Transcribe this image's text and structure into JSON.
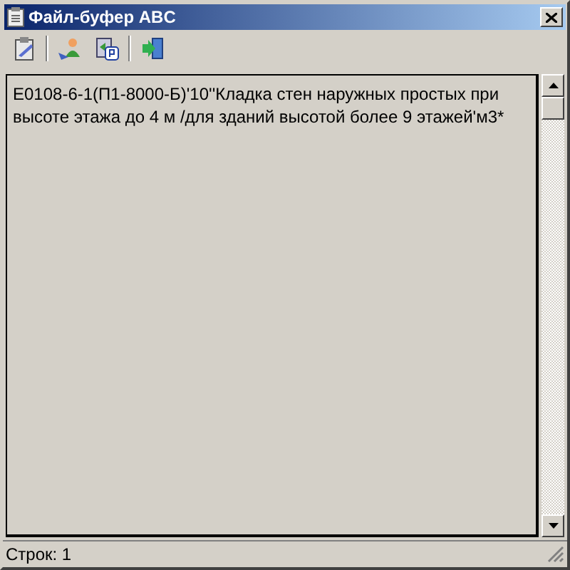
{
  "window": {
    "title": "Файл-буфер ABC"
  },
  "toolbar": [
    {
      "kind": "tool"
    },
    {
      "kind": "separator"
    },
    {
      "kind": "tool"
    },
    {
      "kind": "tool"
    },
    {
      "kind": "separator"
    },
    {
      "kind": "tool"
    }
  ],
  "content": {
    "text": "Е0108-6-1(П1-8000-Б)'10''Кладка стен наружных простых при высоте этажа до 4 м /для зданий высотой более 9 этажей'м3*"
  },
  "status_bar": {
    "text": "Строк: 1"
  }
}
